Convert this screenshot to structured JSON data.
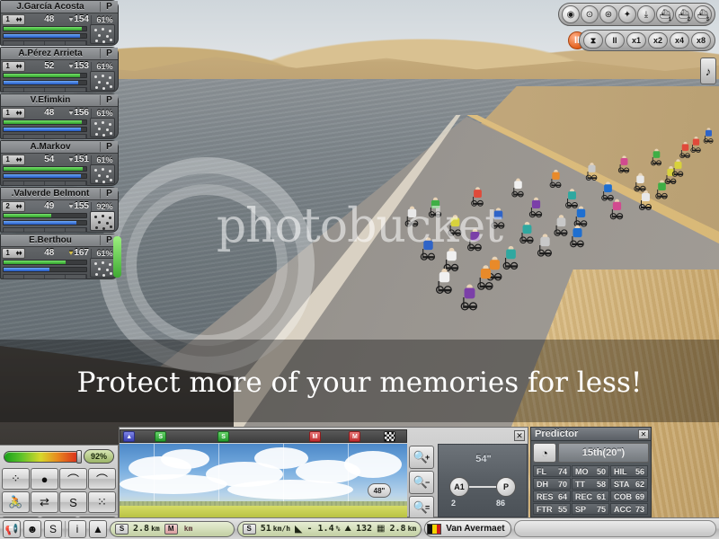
{
  "game": {
    "title": "Pro Cycling Manager - Race 3D",
    "watermark_brand": "photobucket",
    "watermark_tagline": "Protect more of your memories for less!"
  },
  "riders": [
    {
      "name": "J.García Acosta",
      "role": "P",
      "pos": "1",
      "value": "48",
      "heart": "154",
      "pct": "61%",
      "green": 95,
      "blue": 92,
      "selected": false,
      "heart_gold": false
    },
    {
      "name": "A.Pérez Arrieta",
      "role": "P",
      "pos": "1",
      "value": "52",
      "heart": "153",
      "pct": "61%",
      "green": 92,
      "blue": 90,
      "selected": false,
      "heart_gold": false
    },
    {
      "name": "V.Efimkin",
      "role": "P",
      "pos": "1",
      "value": "48",
      "heart": "156",
      "pct": "61%",
      "green": 95,
      "blue": 93,
      "selected": false,
      "heart_gold": false
    },
    {
      "name": "A.Markov",
      "role": "P",
      "pos": "1",
      "value": "54",
      "heart": "151",
      "pct": "61%",
      "green": 96,
      "blue": 94,
      "selected": false,
      "heart_gold": false
    },
    {
      "name": ".Valverde Belmont",
      "role": "P",
      "pos": "2",
      "value": "49",
      "heart": "155",
      "pct": "92%",
      "green": 58,
      "blue": 88,
      "selected": true,
      "heart_gold": false
    },
    {
      "name": "E.Berthou",
      "role": "P",
      "pos": "1",
      "value": "48",
      "heart": "167",
      "pct": "61%",
      "green": 75,
      "blue": 55,
      "selected": false,
      "heart_gold": true
    }
  ],
  "camera_bar": {
    "buttons": [
      {
        "name": "camera-eye",
        "glyph": "◉",
        "label": "Eye camera",
        "num": ""
      },
      {
        "name": "camera-bike-front",
        "glyph": "⊙",
        "label": "Bike front camera",
        "num": ""
      },
      {
        "name": "camera-moto",
        "glyph": "⊛",
        "label": "Moto camera",
        "num": ""
      },
      {
        "name": "camera-helicopter",
        "glyph": "✦",
        "label": "Helicopter camera",
        "num": ""
      },
      {
        "name": "camera-drop",
        "glyph": "⤓",
        "label": "Drop camera",
        "num": ""
      },
      {
        "name": "camera-follow-1",
        "glyph": "⛴",
        "label": "Follow camera 1",
        "num": "1"
      },
      {
        "name": "camera-follow-2",
        "glyph": "⛴",
        "label": "Follow camera 2",
        "num": "2"
      },
      {
        "name": "camera-follow-3",
        "glyph": "⛴",
        "label": "Follow camera 3",
        "num": "3"
      }
    ]
  },
  "speed_bar": {
    "pause_indicator": "II",
    "buttons": [
      {
        "name": "hourglass-button",
        "label": "⧗"
      },
      {
        "name": "pause-button",
        "label": "II"
      },
      {
        "name": "speed-x1-button",
        "label": "x1"
      },
      {
        "name": "speed-x2-button",
        "label": "x2"
      },
      {
        "name": "speed-x4-button",
        "label": "x4"
      },
      {
        "name": "speed-x8-button",
        "label": "x8"
      }
    ]
  },
  "music_button": {
    "glyph": "♪"
  },
  "control_panel": {
    "effort_pct": "92%",
    "buttons_row1": [
      {
        "name": "formation-scatter-button",
        "glyph": "⁘"
      },
      {
        "name": "formation-single-button",
        "glyph": "●"
      },
      {
        "name": "formation-arc-button",
        "glyph": "⌒"
      },
      {
        "name": "formation-arc-relay-button",
        "glyph": "⌒"
      }
    ],
    "buttons_row2": [
      {
        "name": "rider-attack-button",
        "glyph": "🚴"
      },
      {
        "name": "rider-relay-button",
        "glyph": "⇄"
      },
      {
        "name": "sprint-button",
        "glyph": "S"
      },
      {
        "name": "group-select-button",
        "glyph": "⁙"
      }
    ],
    "buttons_row3": [
      {
        "name": "megaphone-button",
        "glyph": "📢"
      },
      {
        "name": "team-radio-button",
        "glyph": "☻"
      },
      {
        "name": "sprint-plan-button",
        "glyph": "S"
      }
    ]
  },
  "profile_panel": {
    "close_label": "✕",
    "markers": [
      {
        "name": "marker-start",
        "type": "start",
        "pos_pct": 1,
        "label": "▲"
      },
      {
        "name": "marker-sprint-1",
        "type": "sprint",
        "pos_pct": 12,
        "label": "S"
      },
      {
        "name": "marker-sprint-2",
        "type": "sprint",
        "pos_pct": 34,
        "label": "S"
      },
      {
        "name": "marker-kom-1",
        "type": "kom",
        "pos_pct": 66,
        "label": "M"
      },
      {
        "name": "marker-kom-2",
        "type": "kom",
        "pos_pct": 80,
        "label": "M"
      },
      {
        "name": "marker-finish",
        "type": "finish",
        "pos_pct": 92,
        "label": ""
      }
    ],
    "distance_bubble": "48\"",
    "zoom_buttons": [
      {
        "name": "zoom-in-button",
        "glyph": "+"
      },
      {
        "name": "zoom-out-button",
        "glyph": "−"
      },
      {
        "name": "zoom-reset-button",
        "glyph": "="
      }
    ],
    "gap": {
      "time": "54\"",
      "left_node": "A1",
      "left_count": "2",
      "right_node": "P",
      "right_count": "86"
    }
  },
  "predictor": {
    "title": "Predictor",
    "close_label": "✕",
    "rank": "15th(20\")",
    "stats": [
      [
        {
          "key": "FL",
          "val": "74"
        },
        {
          "key": "MO",
          "val": "50"
        },
        {
          "key": "HIL",
          "val": "56"
        }
      ],
      [
        {
          "key": "DH",
          "val": "70"
        },
        {
          "key": "TT",
          "val": "58"
        },
        {
          "key": "STA",
          "val": "62"
        }
      ],
      [
        {
          "key": "RES",
          "val": "64"
        },
        {
          "key": "REC",
          "val": "61"
        },
        {
          "key": "COB",
          "val": "69"
        }
      ],
      [
        {
          "key": "FTR",
          "val": "55"
        },
        {
          "key": "SP",
          "val": "75"
        },
        {
          "key": "ACC",
          "val": "73"
        }
      ]
    ]
  },
  "status_bar": {
    "left_buttons": [
      {
        "name": "megaphone-status-button",
        "glyph": "📢"
      },
      {
        "name": "helmet-status-button",
        "glyph": "☻"
      },
      {
        "name": "sprint-status-button",
        "glyph": "S"
      }
    ],
    "info_buttons": [
      {
        "name": "info-button",
        "glyph": "i"
      },
      {
        "name": "profile-toggle-button",
        "glyph": "▲"
      }
    ],
    "distance_group": {
      "sprint_tag": "S",
      "sprint_value": "2.8",
      "sprint_unit": "km",
      "kom_tag": "M",
      "kom_value": "",
      "kom_unit": "km"
    },
    "telemetry_group": {
      "speed_tag": "S",
      "speed_value": "51",
      "speed_unit": "km/h",
      "gradient_value": "- 1.4",
      "gradient_unit": "%",
      "altitude_value": "132",
      "finish_value": "2.8",
      "finish_unit": "km"
    },
    "rider_name": "Van Avermaet"
  }
}
